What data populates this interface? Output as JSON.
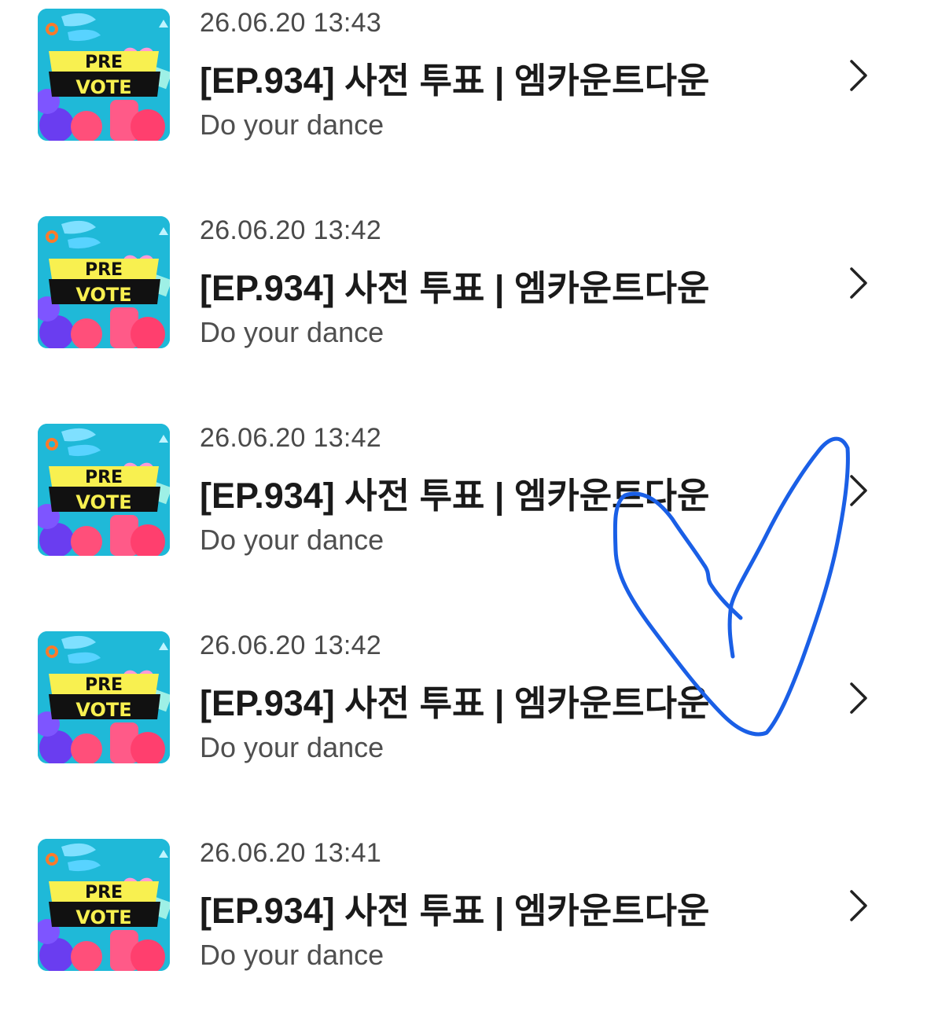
{
  "items": [
    {
      "date": "26.06.20 13:43",
      "title": "[EP.934] 사전 투표 | 엠카운트다운",
      "subtitle": "Do your dance",
      "thumb_line1": "PRE",
      "thumb_line2": "VOTE"
    },
    {
      "date": "26.06.20 13:42",
      "title": "[EP.934] 사전 투표 | 엠카운트다운",
      "subtitle": "Do your dance",
      "thumb_line1": "PRE",
      "thumb_line2": "VOTE"
    },
    {
      "date": "26.06.20 13:42",
      "title": "[EP.934] 사전 투표 | 엠카운트다운",
      "subtitle": "Do your dance",
      "thumb_line1": "PRE",
      "thumb_line2": "VOTE"
    },
    {
      "date": "26.06.20 13:42",
      "title": "[EP.934] 사전 투표 | 엠카운트다운",
      "subtitle": "Do your dance",
      "thumb_line1": "PRE",
      "thumb_line2": "VOTE"
    },
    {
      "date": "26.06.20 13:41",
      "title": "[EP.934] 사전 투표 | 엠카운트다운",
      "subtitle": "Do your dance",
      "thumb_line1": "PRE",
      "thumb_line2": "VOTE"
    }
  ],
  "icons": {
    "row_chevron": "chevron-right-icon",
    "doodle": "hand-drawn-heart"
  },
  "colors": {
    "doodle_stroke": "#1a5fe6",
    "thumb_background": "#1fb9d8",
    "thumb_banner_yellow": "#f8f050",
    "thumb_banner_black": "#111111"
  }
}
